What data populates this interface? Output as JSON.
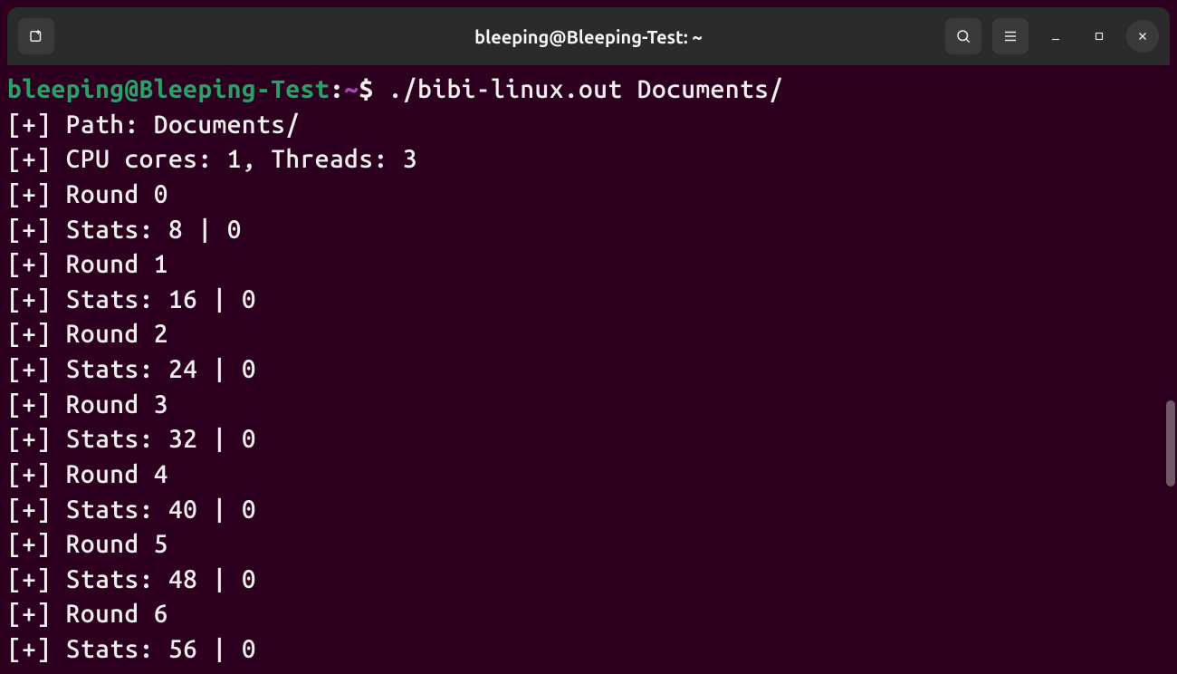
{
  "titlebar": {
    "title": "bleeping@Bleeping-Test: ~"
  },
  "prompt": {
    "user": "bleeping@Bleeping-Test",
    "sep1": ":",
    "path": "~",
    "sep2": "$",
    "command": "./bibi-linux.out Documents/"
  },
  "output": {
    "lines": [
      "[+] Path: Documents/",
      "[+] CPU cores: 1, Threads: 3",
      "[+] Round 0",
      "[+] Stats: 8 | 0",
      "[+] Round 1",
      "[+] Stats: 16 | 0",
      "[+] Round 2",
      "[+] Stats: 24 | 0",
      "[+] Round 3",
      "[+] Stats: 32 | 0",
      "[+] Round 4",
      "[+] Stats: 40 | 0",
      "[+] Round 5",
      "[+] Stats: 48 | 0",
      "[+] Round 6",
      "[+] Stats: 56 | 0"
    ]
  }
}
